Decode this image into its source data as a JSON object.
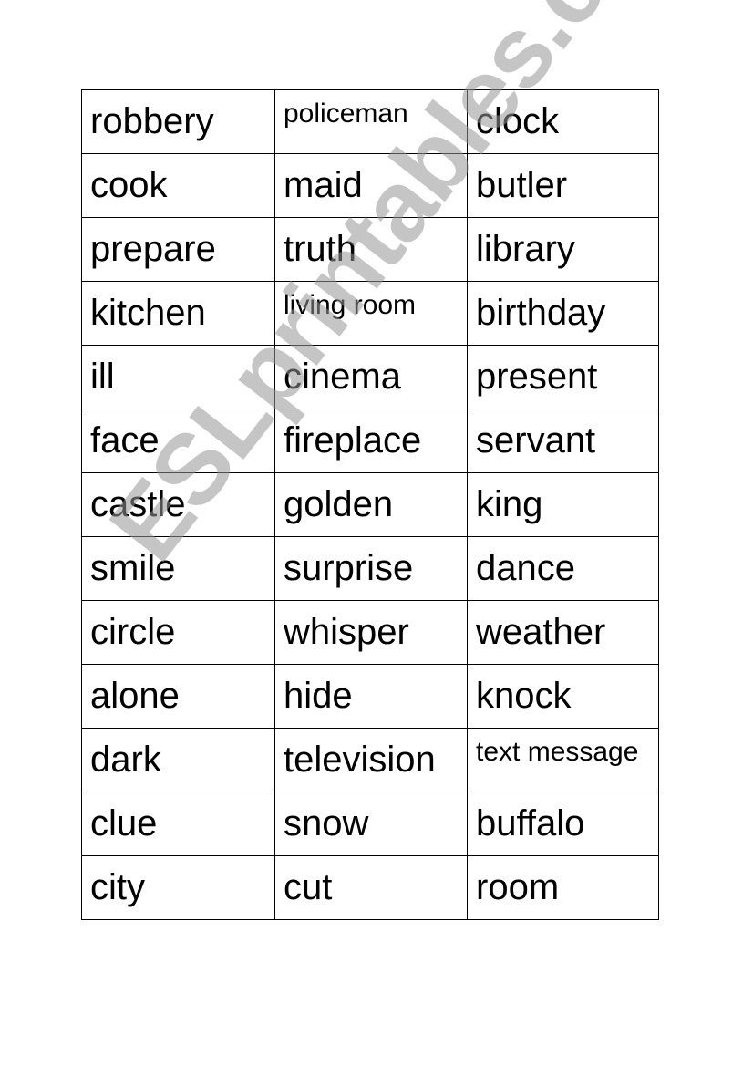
{
  "worksheet": {
    "rows": [
      [
        "robbery",
        "policeman",
        "clock"
      ],
      [
        "cook",
        "maid",
        "butler"
      ],
      [
        "prepare",
        "truth",
        "library"
      ],
      [
        "kitchen",
        "living room",
        "birthday"
      ],
      [
        "ill",
        "cinema",
        "present"
      ],
      [
        "face",
        "fireplace",
        "servant"
      ],
      [
        "castle",
        "golden",
        "king"
      ],
      [
        "smile",
        "surprise",
        "dance"
      ],
      [
        "circle",
        "whisper",
        "weather"
      ],
      [
        "alone",
        "hide",
        "knock"
      ],
      [
        "dark",
        "television",
        "text message"
      ],
      [
        "clue",
        "snow",
        "buffalo"
      ],
      [
        "city",
        "cut",
        "room"
      ]
    ],
    "small_text_cells": [
      "policeman",
      "living room",
      "text message"
    ]
  },
  "watermark": {
    "text": "ESLprintables.com",
    "color": "#9a9a9a"
  }
}
